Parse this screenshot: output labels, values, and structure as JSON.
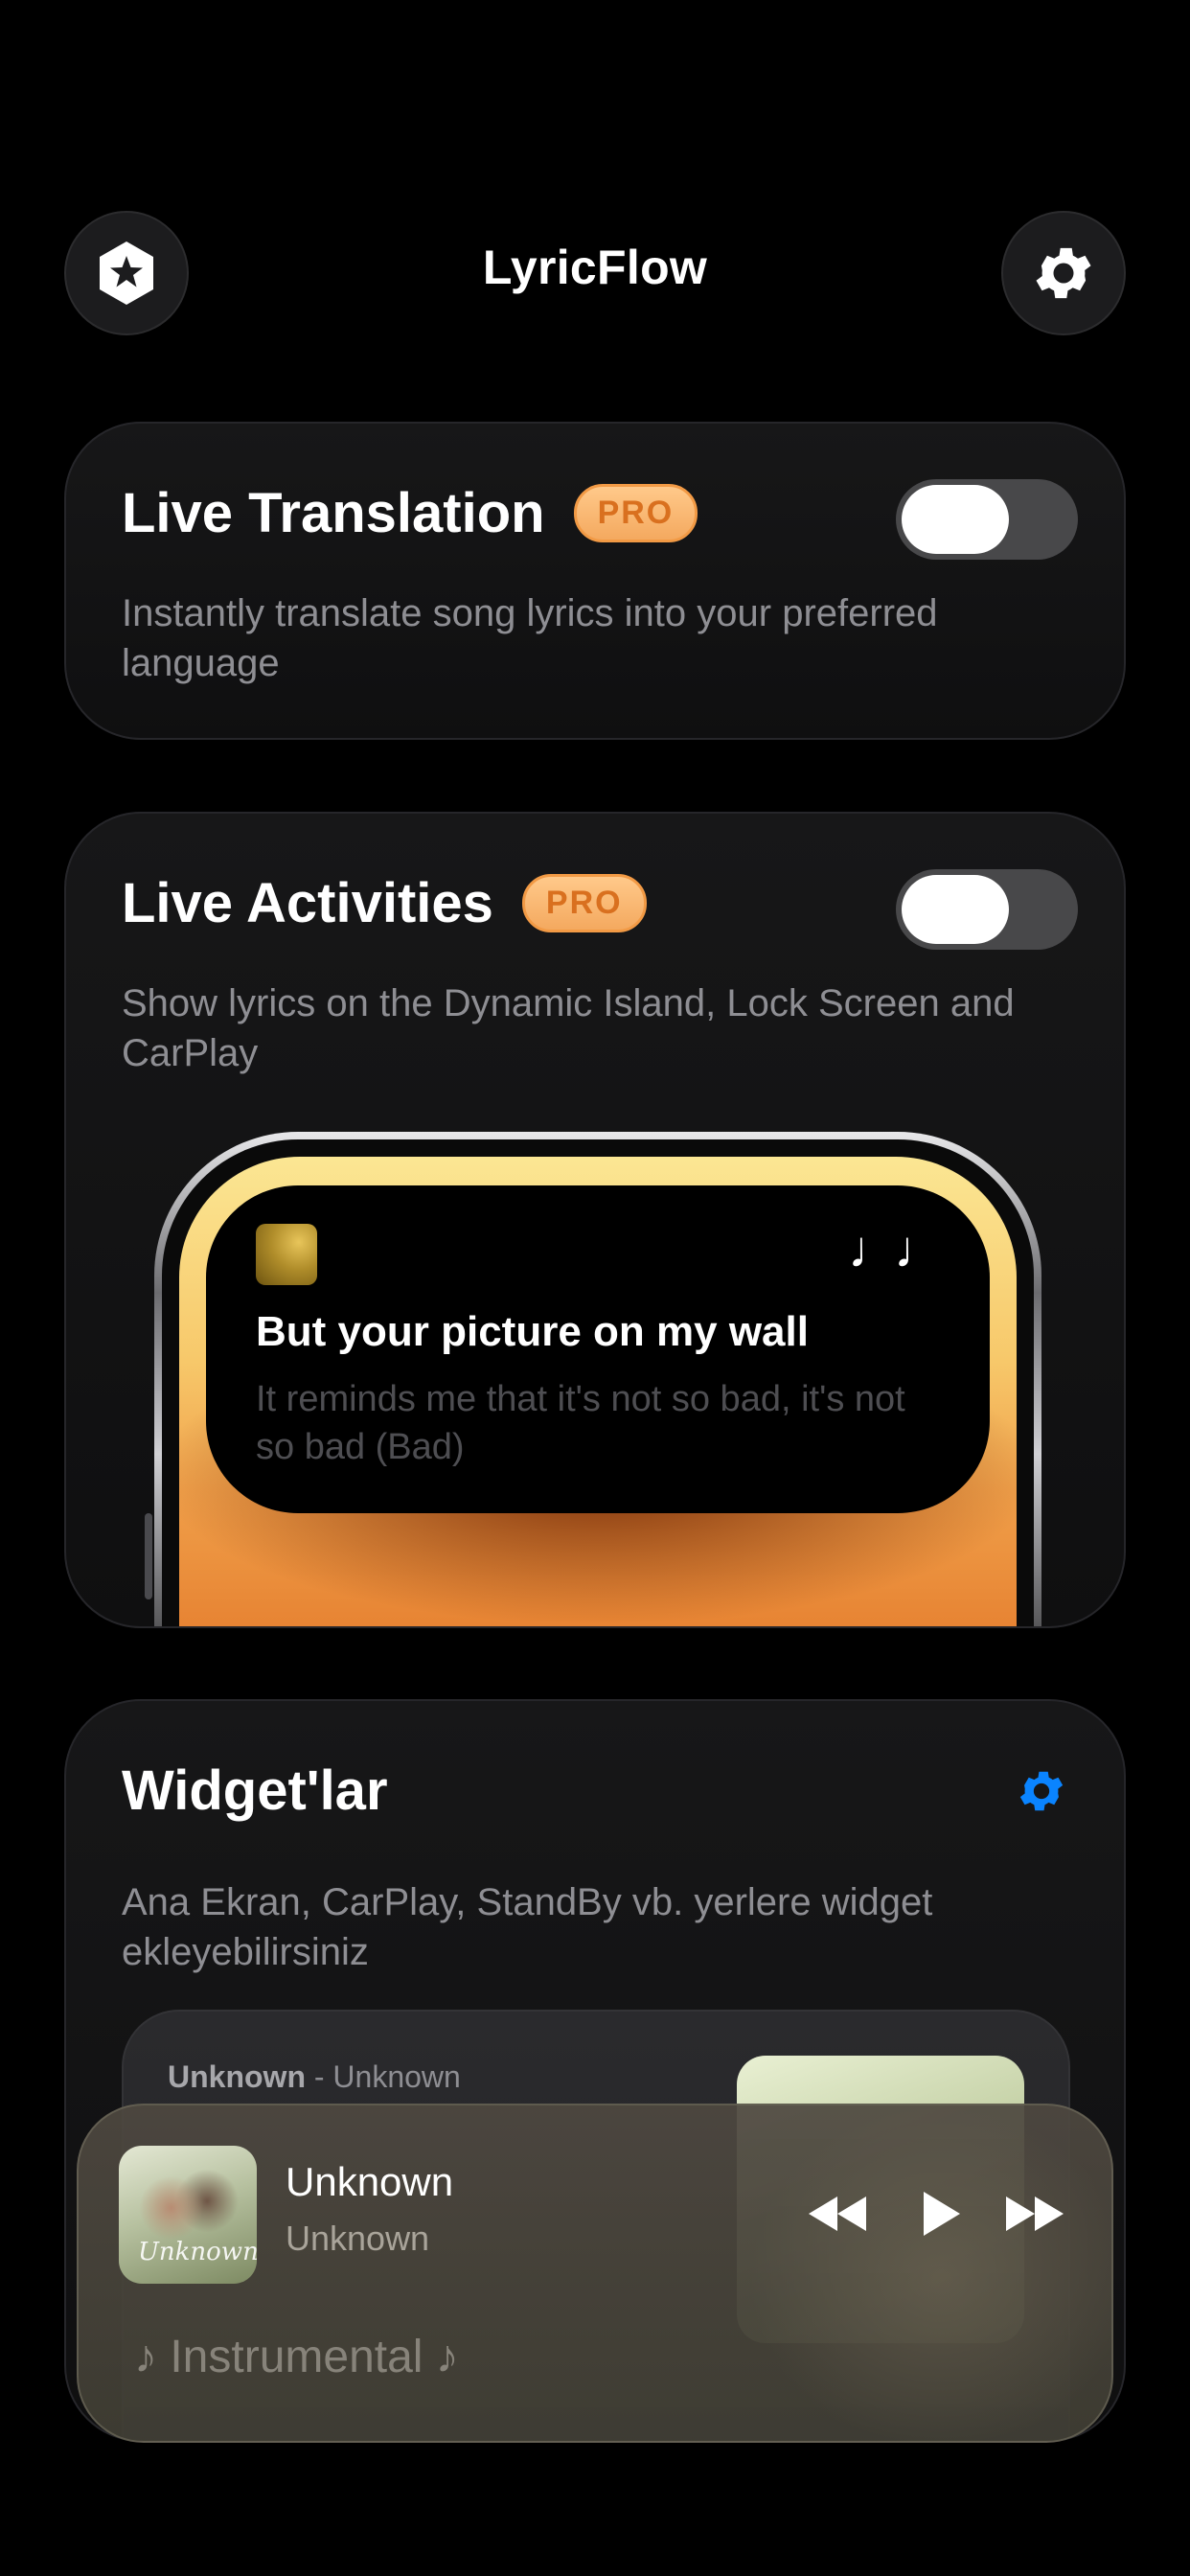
{
  "header": {
    "title": "LyricFlow",
    "left_button_icon": "star-badge-icon",
    "right_button_icon": "gear-icon"
  },
  "live_translation": {
    "title": "Live Translation",
    "badge": "PRO",
    "description": "Instantly translate song lyrics into your preferred language",
    "toggle_on": false
  },
  "live_activities": {
    "title": "Live Activities",
    "badge": "PRO",
    "description": "Show lyrics on the Dynamic Island, Lock Screen and CarPlay",
    "toggle_on": false,
    "preview": {
      "current_line": "But your picture on my wall",
      "next_line": "It reminds me that it's not so bad, it's not so bad (Bad)",
      "note_glyph": "♩♩"
    }
  },
  "widgets": {
    "title": "Widget'lar",
    "description": "Ana Ekran, CarPlay, StandBy vb. yerlere widget ekleyebilirsiniz",
    "settings_icon": "gear-icon",
    "preview": {
      "song": "Unknown",
      "separator": " - ",
      "artist": "Unknown"
    }
  },
  "mini_player": {
    "song": "Unknown",
    "artist": "Unknown",
    "lyric": "♪ Instrumental ♪",
    "album_caption": "Unknown",
    "controls": [
      "rewind-icon",
      "play-icon",
      "fast-forward-icon"
    ]
  },
  "colors": {
    "background": "#000000",
    "card": "#151516",
    "pro_badge": "#f4a95f",
    "accent_blue": "#0a84ff",
    "secondary_text": "#8e8e93"
  }
}
